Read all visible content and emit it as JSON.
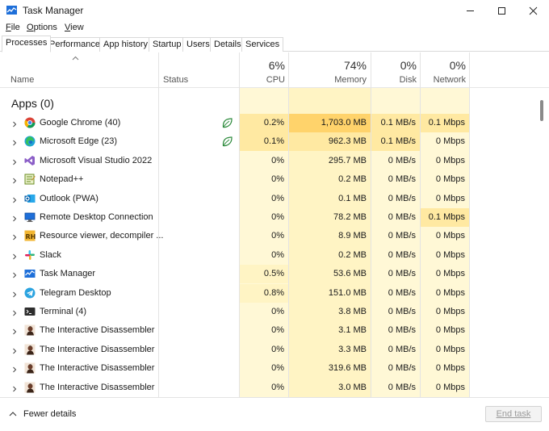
{
  "window": {
    "title": "Task Manager"
  },
  "menu": [
    {
      "underline": "F",
      "rest": "ile"
    },
    {
      "underline": "O",
      "rest": "ptions"
    },
    {
      "underline": "V",
      "rest": "iew"
    }
  ],
  "tabs": [
    "Processes",
    "Performance",
    "App history",
    "Startup",
    "Users",
    "Details",
    "Services"
  ],
  "active_tab": "Processes",
  "columns": {
    "name": "Name",
    "status": "Status",
    "cpu": {
      "pct": "6%",
      "label": "CPU"
    },
    "memory": {
      "pct": "74%",
      "label": "Memory"
    },
    "disk": {
      "pct": "0%",
      "label": "Disk"
    },
    "network": {
      "pct": "0%",
      "label": "Network"
    }
  },
  "group_title": "Apps (0)",
  "processes": [
    {
      "name": "Google Chrome (40)",
      "icon": "chrome-icon",
      "leaf": true,
      "cpu": "0.2%",
      "memory": "1,703.0 MB",
      "disk": "0.1 MB/s",
      "network": "0.1 Mbps"
    },
    {
      "name": "Microsoft Edge (23)",
      "icon": "edge-icon",
      "leaf": true,
      "cpu": "0.1%",
      "memory": "962.3 MB",
      "disk": "0.1 MB/s",
      "network": "0 Mbps"
    },
    {
      "name": "Microsoft Visual Studio 2022",
      "icon": "visual-studio-icon",
      "leaf": false,
      "cpu": "0%",
      "memory": "295.7 MB",
      "disk": "0 MB/s",
      "network": "0 Mbps"
    },
    {
      "name": "Notepad++",
      "icon": "notepad-plus-plus-icon",
      "leaf": false,
      "cpu": "0%",
      "memory": "0.2 MB",
      "disk": "0 MB/s",
      "network": "0 Mbps"
    },
    {
      "name": "Outlook (PWA)",
      "icon": "outlook-icon",
      "leaf": false,
      "cpu": "0%",
      "memory": "0.1 MB",
      "disk": "0 MB/s",
      "network": "0 Mbps"
    },
    {
      "name": "Remote Desktop Connection",
      "icon": "remote-desktop-icon",
      "leaf": false,
      "cpu": "0%",
      "memory": "78.2 MB",
      "disk": "0 MB/s",
      "network": "0.1 Mbps"
    },
    {
      "name": "Resource viewer, decompiler ...",
      "icon": "resource-viewer-icon",
      "leaf": false,
      "cpu": "0%",
      "memory": "8.9 MB",
      "disk": "0 MB/s",
      "network": "0 Mbps"
    },
    {
      "name": "Slack",
      "icon": "slack-icon",
      "leaf": false,
      "cpu": "0%",
      "memory": "0.2 MB",
      "disk": "0 MB/s",
      "network": "0 Mbps"
    },
    {
      "name": "Task Manager",
      "icon": "task-manager-icon",
      "leaf": false,
      "cpu": "0.5%",
      "memory": "53.6 MB",
      "disk": "0 MB/s",
      "network": "0 Mbps"
    },
    {
      "name": "Telegram Desktop",
      "icon": "telegram-icon",
      "leaf": false,
      "cpu": "0.8%",
      "memory": "151.0 MB",
      "disk": "0 MB/s",
      "network": "0 Mbps"
    },
    {
      "name": "Terminal (4)",
      "icon": "terminal-icon",
      "leaf": false,
      "cpu": "0%",
      "memory": "3.8 MB",
      "disk": "0 MB/s",
      "network": "0 Mbps"
    },
    {
      "name": "The Interactive Disassembler",
      "icon": "ida-icon",
      "leaf": false,
      "cpu": "0%",
      "memory": "3.1 MB",
      "disk": "0 MB/s",
      "network": "0 Mbps"
    },
    {
      "name": "The Interactive Disassembler",
      "icon": "ida-icon",
      "leaf": false,
      "cpu": "0%",
      "memory": "3.3 MB",
      "disk": "0 MB/s",
      "network": "0 Mbps"
    },
    {
      "name": "The Interactive Disassembler",
      "icon": "ida-icon",
      "leaf": false,
      "cpu": "0%",
      "memory": "319.6 MB",
      "disk": "0 MB/s",
      "network": "0 Mbps"
    },
    {
      "name": "The Interactive Disassembler",
      "icon": "ida-icon",
      "leaf": false,
      "cpu": "0%",
      "memory": "3.0 MB",
      "disk": "0 MB/s",
      "network": "0 Mbps"
    }
  ],
  "footer": {
    "fewer_details": "Fewer details",
    "end_task": "End task"
  },
  "colors": {
    "heat_light": "#fff4c4",
    "heat_mid": "#ffe9a2",
    "heat_strong": "#ffd36b",
    "cpu_header_bg": "#fff8d6",
    "leaf_green": "#2e8b3d"
  }
}
